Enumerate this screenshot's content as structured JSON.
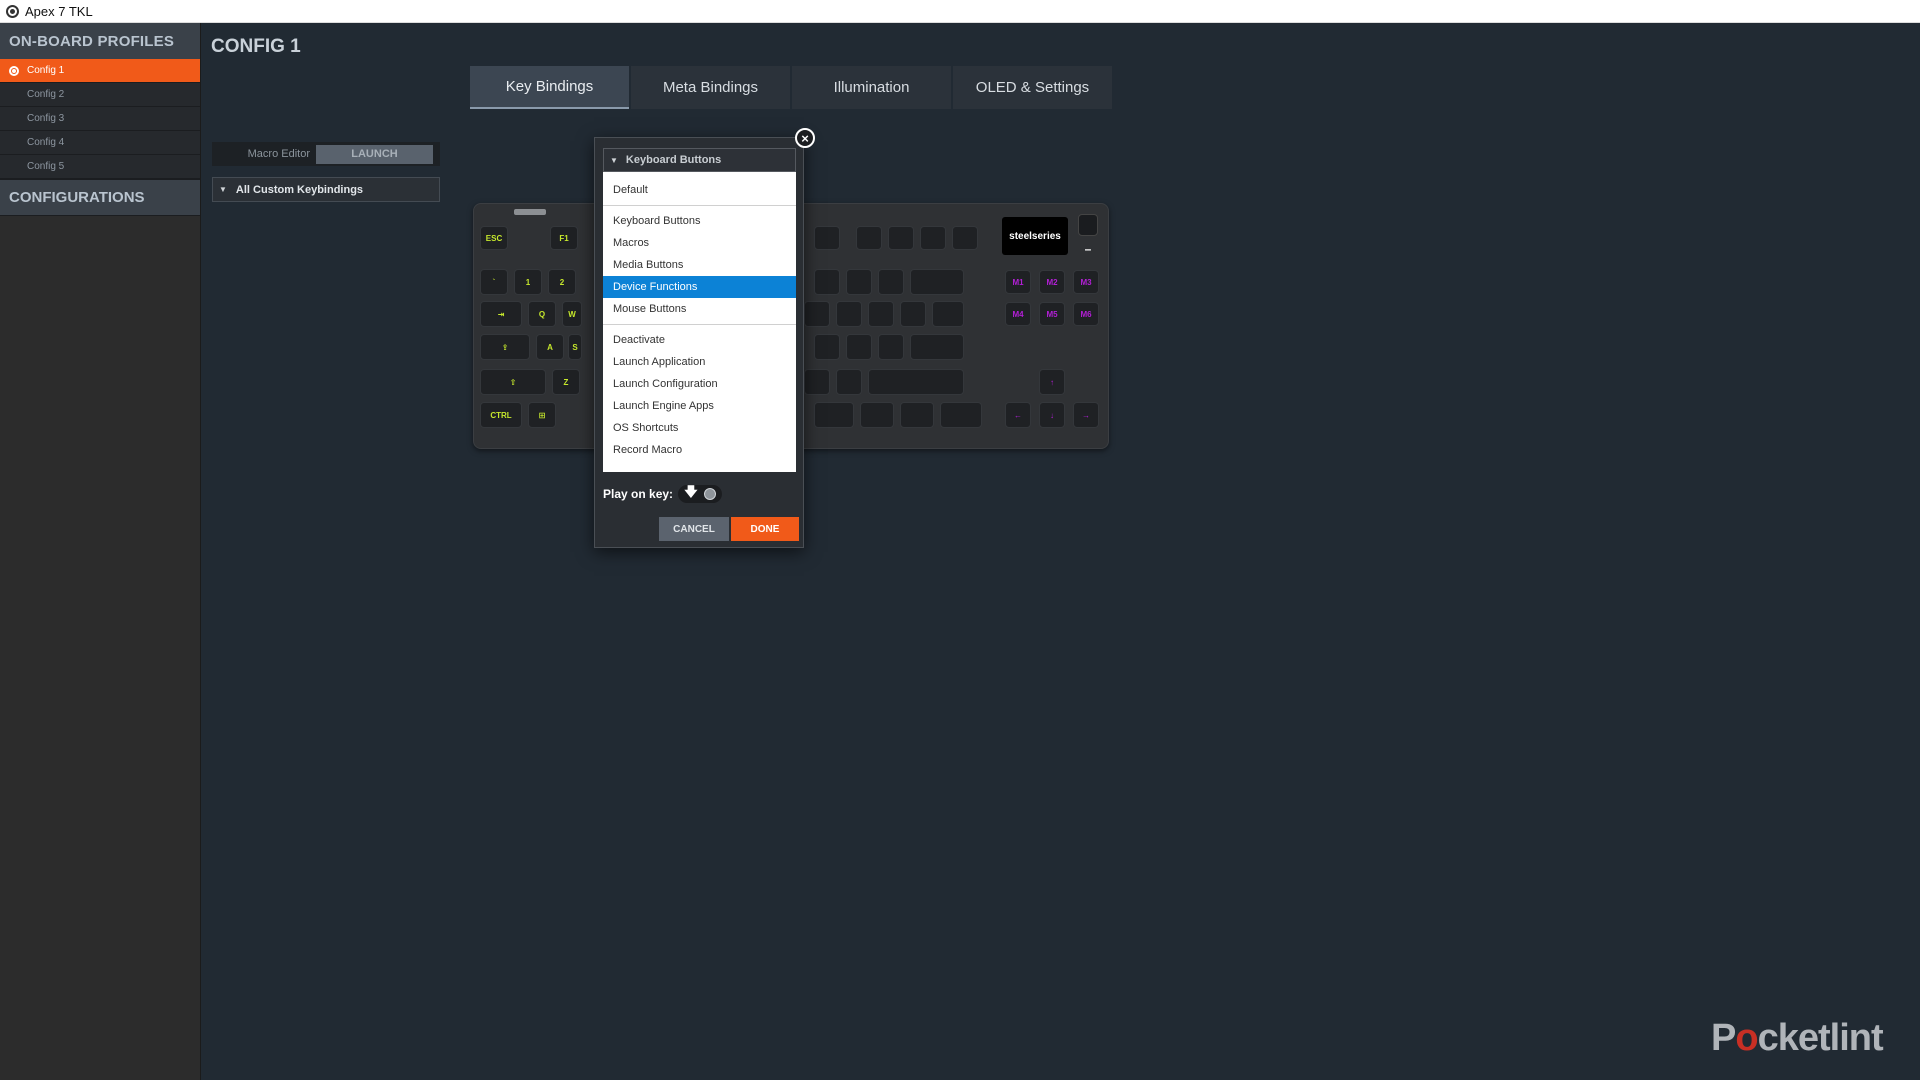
{
  "window": {
    "title": "Apex 7 TKL"
  },
  "sidebar": {
    "profiles_header": "ON-BOARD PROFILES",
    "profiles": [
      "Config 1",
      "Config 2",
      "Config 3",
      "Config 4",
      "Config 5"
    ],
    "active_profile": 0,
    "configurations_header": "CONFIGURATIONS"
  },
  "main": {
    "title": "CONFIG 1",
    "tabs": [
      "Key Bindings",
      "Meta Bindings",
      "Illumination",
      "OLED & Settings"
    ],
    "active_tab": 0,
    "macro_editor_label": "Macro Editor",
    "launch_label": "LAUNCH",
    "keybindings_select": "All Custom Keybindings"
  },
  "keyboard": {
    "oled_text": "steelseries",
    "keys_left": [
      "ESC",
      "F1",
      "`",
      "1",
      "2",
      "⇥",
      "Q",
      "W",
      "⇪",
      "A",
      "S",
      "⇧",
      "Z",
      "CTRL",
      "⊞"
    ],
    "macro_keys": [
      "M1",
      "M2",
      "M3",
      "M4",
      "M5",
      "M6"
    ],
    "arrow_keys": [
      "↑",
      "←",
      "↓",
      "→"
    ],
    "minus": "–"
  },
  "dialog": {
    "dropdown_header": "Keyboard Buttons",
    "group1": [
      "Default"
    ],
    "group2": [
      "Keyboard Buttons",
      "Macros",
      "Media Buttons",
      "Device Functions",
      "Mouse Buttons"
    ],
    "group3": [
      "Deactivate",
      "Launch Application",
      "Launch Configuration",
      "Launch Engine Apps",
      "OS Shortcuts",
      "Record Macro"
    ],
    "selected_item": "Device Functions",
    "play_on_key_label": "Play on key:",
    "cancel_label": "CANCEL",
    "done_label": "DONE",
    "close_glyph": "×"
  },
  "watermark": {
    "before": "P",
    "o": "o",
    "after": "cketlint"
  },
  "colors": {
    "accent": "#f15a19",
    "selection": "#0c82d6",
    "background": "#212a33"
  },
  "icons": [
    "app-icon",
    "radio-dot-icon",
    "triangle-down-icon",
    "close-icon",
    "down-arrow-icon",
    "circle-icon"
  ]
}
